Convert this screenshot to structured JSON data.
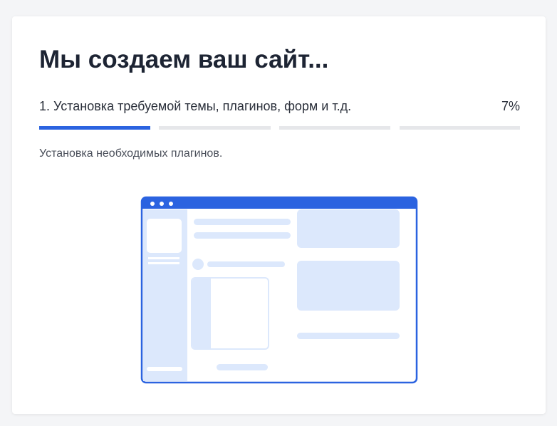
{
  "header": {
    "title": "Мы создаем ваш сайт..."
  },
  "progress": {
    "step_label": "1. Установка требуемой темы, плагинов, форм и т.д.",
    "percent_label": "7%",
    "segments": [
      {
        "fill": 1.0
      },
      {
        "fill": 0.0
      },
      {
        "fill": 0.0
      },
      {
        "fill": 0.0
      }
    ]
  },
  "status": {
    "text": "Установка необходимых плагинов."
  },
  "illustration": {
    "icon": "website-builder-illustration"
  },
  "colors": {
    "accent": "#2b63e0",
    "track": "#e6e7ea",
    "placeholder": "#dce8fc",
    "title": "#1d2433"
  }
}
